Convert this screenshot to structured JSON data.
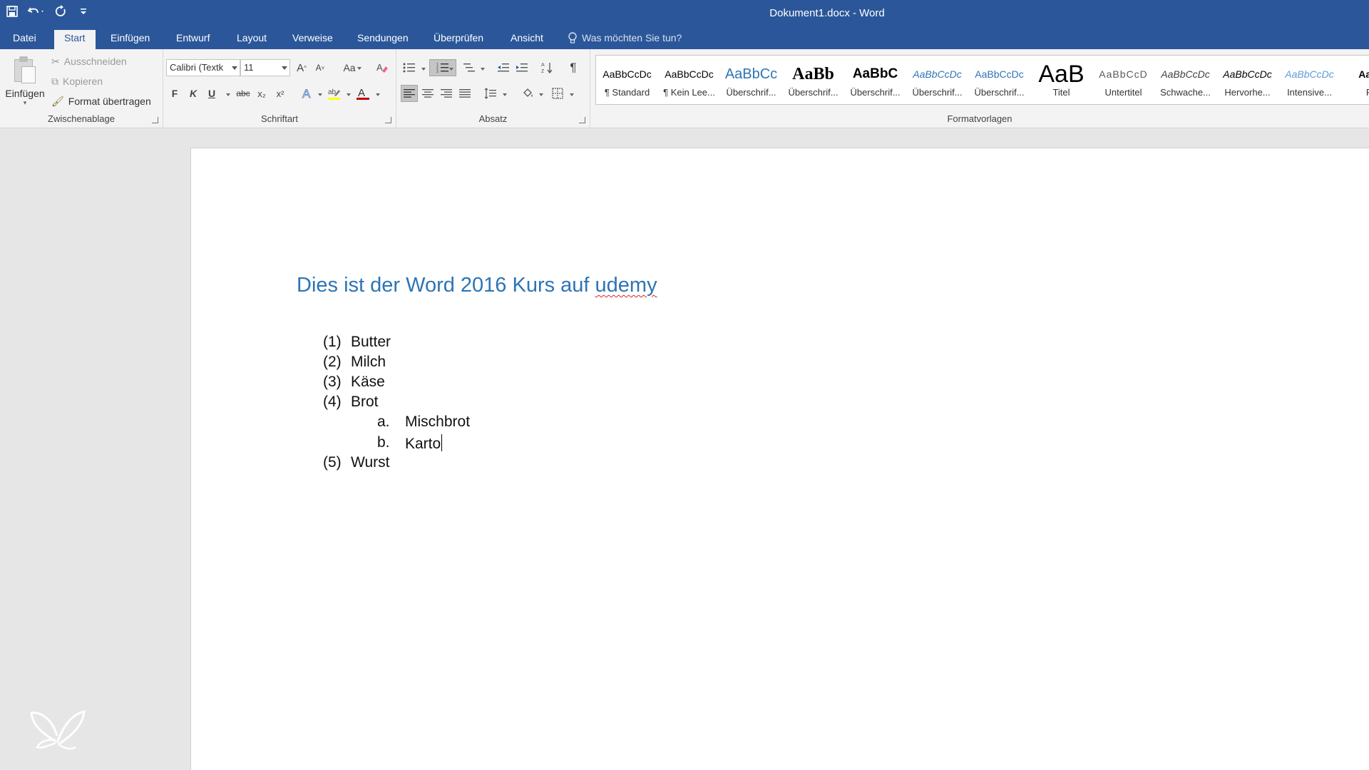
{
  "window": {
    "title": "Dokument1.docx - Word"
  },
  "quick_access": [
    {
      "icon": "save-icon"
    },
    {
      "icon": "undo-icon"
    },
    {
      "icon": "redo-icon"
    },
    {
      "icon": "customize-icon"
    }
  ],
  "tabs": [
    "Datei",
    "Start",
    "Einfügen",
    "Entwurf",
    "Layout",
    "Verweise",
    "Sendungen",
    "Überprüfen",
    "Ansicht"
  ],
  "active_tab": "Start",
  "tell_me": "Was möchten Sie tun?",
  "clipboard": {
    "paste": "Einfügen",
    "cut": "Ausschneiden",
    "copy": "Kopieren",
    "format_painter": "Format übertragen",
    "label": "Zwischenablage"
  },
  "font": {
    "family": "Calibri (Textk",
    "size": "11",
    "grow": "A",
    "shrink": "A",
    "case": "Aa",
    "bold": "F",
    "italic": "K",
    "underline": "U",
    "strike": "abc",
    "subscript": "x₂",
    "superscript": "x²",
    "label": "Schriftart",
    "font_color": "#c00000",
    "highlight_color": "#ffff00"
  },
  "paragraph": {
    "label": "Absatz",
    "pilcrow": "¶"
  },
  "styles": {
    "label": "Formatvorlagen",
    "items": [
      {
        "sample": "AaBbCcDc",
        "name": "¶ Standard"
      },
      {
        "sample": "AaBbCcDc",
        "name": "¶ Kein Lee..."
      },
      {
        "sample": "AaBbCc",
        "name": "Überschrif..."
      },
      {
        "sample": "AaBb",
        "name": "Überschrif..."
      },
      {
        "sample": "AaBbC",
        "name": "Überschrif..."
      },
      {
        "sample": "AaBbCcDc",
        "name": "Überschrif..."
      },
      {
        "sample": "AaBbCcDc",
        "name": "Überschrif..."
      },
      {
        "sample": "AaB",
        "name": "Titel"
      },
      {
        "sample": "AaBbCcD",
        "name": "Untertitel"
      },
      {
        "sample": "AaBbCcDc",
        "name": "Schwache..."
      },
      {
        "sample": "AaBbCcDc",
        "name": "Hervorhe..."
      },
      {
        "sample": "AaBbCcDc",
        "name": "Intensive..."
      },
      {
        "sample": "AaBb",
        "name": "Fe"
      }
    ]
  },
  "document": {
    "heading_prefix": "Dies ist der Word 2016 Kurs auf ",
    "heading_misspelled": "udemy",
    "heading_color": "#2e74b5",
    "list": [
      {
        "num": "(1)",
        "text": "Butter",
        "level": 0
      },
      {
        "num": "(2)",
        "text": "Milch",
        "level": 0
      },
      {
        "num": "(3)",
        "text": "Käse",
        "level": 0
      },
      {
        "num": "(4)",
        "text": "Brot",
        "level": 0
      },
      {
        "num": "a.",
        "text": "Mischbrot",
        "level": 1
      },
      {
        "num": "b.",
        "text": "Karto",
        "level": 1
      },
      {
        "num": "(5)",
        "text": "Wurst",
        "level": 0
      }
    ]
  }
}
